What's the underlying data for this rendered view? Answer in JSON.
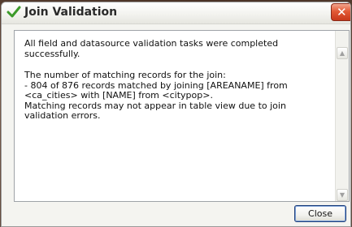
{
  "dialog": {
    "title": "Join Validation",
    "close_glyph": "✕",
    "title_icon": "checkmark-icon"
  },
  "message": {
    "line1": "All field and datasource validation tasks were completed successfully.",
    "line2": "The number of matching records for the join:",
    "line3": "- 804 of 876 records matched by joining [AREANAME] from <ca_cities> with [NAME] from <citypop>.",
    "line4": "Matching records may not appear in table view due to join validation errors."
  },
  "scrollbar": {
    "up_glyph": "▲",
    "down_glyph": "▼"
  },
  "buttons": {
    "close_label": "Close"
  },
  "colors": {
    "accent_check": "#3c9a2a",
    "close_button": "#d64a28",
    "button_focus_border": "#1f3f7a"
  }
}
